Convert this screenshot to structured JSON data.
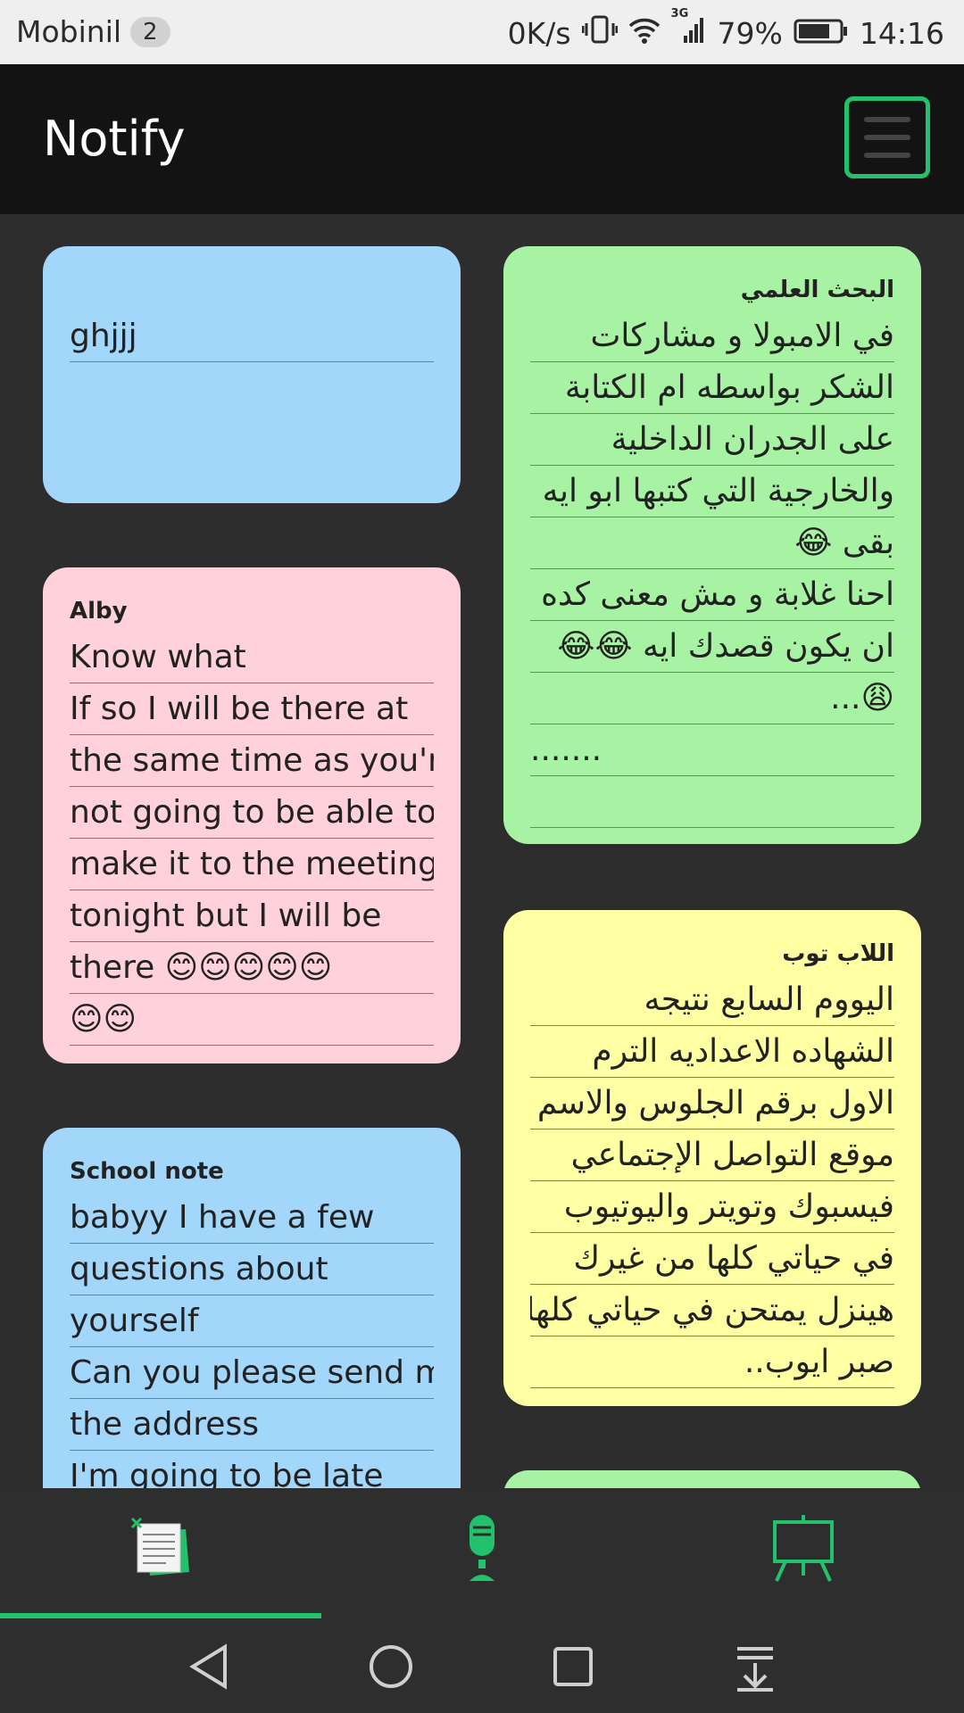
{
  "status_bar": {
    "carrier": "Mobinil",
    "notifications": "2",
    "speed": "0K/s",
    "network": "3G",
    "battery": "79%",
    "time": "14:16"
  },
  "app_bar": {
    "title": "Notify"
  },
  "notes": [
    {
      "title": "",
      "color": "#a2d6fb",
      "lines": [
        "ghjjj"
      ]
    },
    {
      "title": "البحث العلمي",
      "color": "#a8f2a4",
      "lines": [
        "في الامبولا و مشاركات",
        "الشكر بواسطه ام الكتابة",
        "على الجدران الداخلية",
        "والخارجية التي كتبها ابو ايه",
        "بقى 😂",
        "احنا غلابة و مش معنى كده",
        "ان يكون قصدك ايه 😂😂",
        "😩...",
        ".......",
        ""
      ]
    },
    {
      "title": "Alby",
      "color": "#ffd1db",
      "lines": [
        "Know what",
        "If so I will be there at",
        "the same time as you're",
        "not going to be able to",
        "make it to the meeting",
        "tonight but I will be",
        "there 😊😊😊😊😊",
        "😊😊"
      ]
    },
    {
      "title": "اللاب توب",
      "color": "#ffffa4",
      "lines": [
        "اليووم السابع نتيجه",
        "الشهاده الاعداديه الترم",
        "الاول برقم الجلوس والاسم",
        "موقع التواصل الإجتماعي",
        "فيسبوك وتويتر واليوتيوب",
        "في حياتي كلها من غيرك",
        "هينزل يمتحن في حياتي كلها",
        "صبر ايوب.."
      ]
    },
    {
      "title": "School note",
      "color": "#a2d6fb",
      "lines": [
        "babyy I have a few",
        "questions about",
        "yourself",
        "Can you please send me",
        "the address",
        "I'm going to be late"
      ]
    }
  ],
  "bottom_nav": {
    "items": [
      {
        "icon": "notes-icon",
        "active": true
      },
      {
        "icon": "microphone-icon",
        "active": false
      },
      {
        "icon": "whiteboard-icon",
        "active": false
      }
    ],
    "accent": "#22c16b"
  },
  "system_nav": {
    "buttons": [
      "back-icon",
      "home-icon",
      "recents-icon",
      "notification-pull-icon"
    ]
  }
}
